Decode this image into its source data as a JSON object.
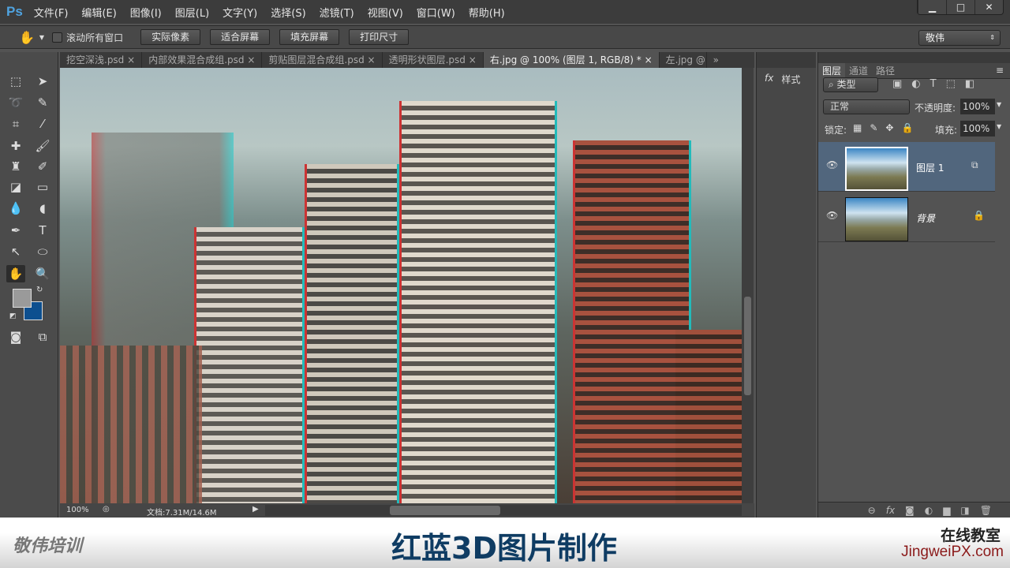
{
  "app": {
    "logo": "Ps",
    "menus": [
      "文件(F)",
      "编辑(E)",
      "图像(I)",
      "图层(L)",
      "文字(Y)",
      "选择(S)",
      "滤镜(T)",
      "视图(V)",
      "窗口(W)",
      "帮助(H)"
    ],
    "window_controls": [
      "▁",
      "□",
      "✕"
    ]
  },
  "options": {
    "scroll_all_label": "滚动所有窗口",
    "buttons": [
      "实际像素",
      "适合屏幕",
      "填充屏幕",
      "打印尺寸"
    ],
    "workspace": "敬伟"
  },
  "tabs": [
    {
      "label": "挖空深浅.psd",
      "active": false
    },
    {
      "label": "内部效果混合成组.psd",
      "active": false
    },
    {
      "label": "剪贴图层混合成组.psd",
      "active": false
    },
    {
      "label": "透明形状图层.psd",
      "active": false
    },
    {
      "label": "右.jpg @ 100% (图层 1, RGB/8) *",
      "active": true
    },
    {
      "label": "左.jpg @",
      "active": false
    }
  ],
  "status": {
    "zoom": "100%",
    "doc": "文档:7.31M/14.6M"
  },
  "styles_panel": {
    "label": "样式"
  },
  "layers_panel": {
    "tabs": [
      "图层",
      "通道",
      "路径"
    ],
    "filter": "类型",
    "blend_mode": "正常",
    "opacity_label": "不透明度:",
    "opacity": "100%",
    "lock_label": "锁定:",
    "fill_label": "填充:",
    "fill": "100%",
    "layers": [
      {
        "name": "图层 1",
        "selected": true
      },
      {
        "name": "背景",
        "selected": false
      }
    ]
  },
  "banner": {
    "brand": "敬伟培训",
    "title": "红蓝3D图片制作",
    "subtitle": "在线教室",
    "site": "JingweiPX.com"
  },
  "colors": {
    "foreground": "#9a9a9a",
    "background": "#0d4f8f",
    "accent": "#4fa3e0"
  }
}
